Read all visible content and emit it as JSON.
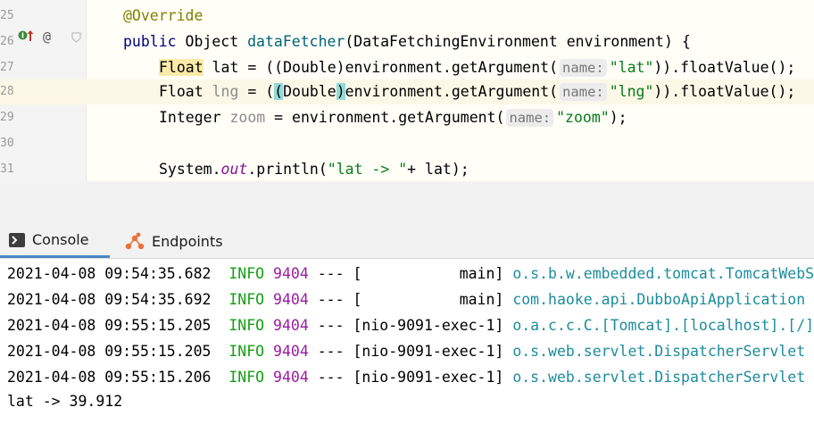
{
  "editor": {
    "lines": [
      {
        "num": "25",
        "code": {
          "annotation": "@Override"
        }
      },
      {
        "num": "26",
        "code": {
          "kw_public": "public",
          "type": " Object ",
          "method": "dataFetcher",
          "params": "(DataFetchingEnvironment environment) {"
        }
      },
      {
        "num": "27",
        "code": {
          "type": "Float",
          "var": " lat = ((Double)environment.getArgument(",
          "hint": "name:",
          "str": "\"lat\"",
          "tail": ")).floatValue();"
        }
      },
      {
        "num": "28",
        "code": {
          "type": "Float",
          "var": " lng",
          "eq": " = (",
          "paren_open": "(",
          "cast": "Double",
          "paren_close": ")",
          "rest": "environment.getArgument(",
          "hint": "name:",
          "str": "\"lng\"",
          "tail": ")).floatValue();"
        }
      },
      {
        "num": "29",
        "code": {
          "type": "Integer ",
          "var": "zoom",
          "rest": " = environment.getArgument(",
          "hint": "name:",
          "str": "\"zoom\"",
          "tail": ");"
        }
      },
      {
        "num": "30",
        "code": {}
      },
      {
        "num": "31",
        "code": {
          "cls": "System.",
          "field": "out",
          "call": ".println(",
          "str": "\"lat -> \"",
          "tail": "+ lat);"
        }
      }
    ],
    "gutter_icons": {
      "implements": "implements-icon",
      "override": "override-arrow-icon",
      "annotation": "at-sign-icon",
      "fold": "fold-icon"
    }
  },
  "tabs": [
    {
      "label": "Console",
      "icon": "console-icon",
      "active": true
    },
    {
      "label": "Endpoints",
      "icon": "endpoints-icon",
      "active": false
    }
  ],
  "console": {
    "logs": [
      {
        "ts": "2021-04-08 09:54:35.682",
        "level": "INFO",
        "pid": "9404",
        "sep": "---",
        "thread": "[           main]",
        "logger": "o.s.b.w.embedded.tomcat.TomcatWebS"
      },
      {
        "ts": "2021-04-08 09:54:35.692",
        "level": "INFO",
        "pid": "9404",
        "sep": "---",
        "thread": "[           main]",
        "logger": "com.haoke.api.DubboApiApplication"
      },
      {
        "ts": "2021-04-08 09:55:15.205",
        "level": "INFO",
        "pid": "9404",
        "sep": "---",
        "thread": "[nio-9091-exec-1]",
        "logger": "o.a.c.c.C.[Tomcat].[localhost].[/]"
      },
      {
        "ts": "2021-04-08 09:55:15.205",
        "level": "INFO",
        "pid": "9404",
        "sep": "---",
        "thread": "[nio-9091-exec-1]",
        "logger": "o.s.web.servlet.DispatcherServlet"
      },
      {
        "ts": "2021-04-08 09:55:15.206",
        "level": "INFO",
        "pid": "9404",
        "sep": "---",
        "thread": "[nio-9091-exec-1]",
        "logger": "o.s.web.servlet.DispatcherServlet"
      }
    ],
    "output": "lat -> 39.912"
  },
  "colors": {
    "keyword": "#000080",
    "string": "#067d17",
    "annotation": "#808000",
    "info": "#11a011",
    "pid": "#9c1ca0",
    "logger": "#1c8c9c",
    "active_tab": "#4a88c7"
  }
}
